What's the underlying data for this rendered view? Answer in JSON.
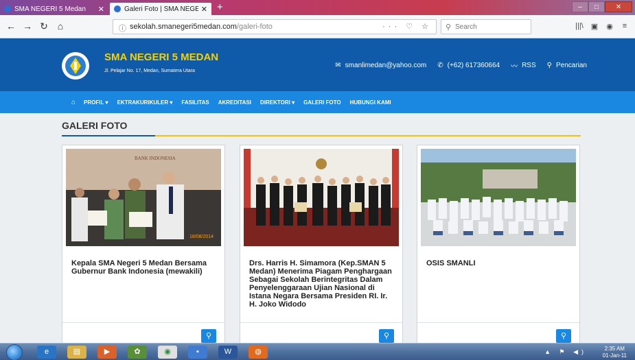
{
  "browser": {
    "tabs": [
      {
        "title": "SMA NEGERI 5 Medan"
      },
      {
        "title": "Galeri Foto | SMA NEGERI 5 Me"
      }
    ],
    "url_domain": "sekolah.smanegeri5medan.com",
    "url_path": "/galeri-foto",
    "search_placeholder": "Search"
  },
  "site": {
    "name": "SMA NEGERI 5 MEDAN",
    "address": "Jl. Pelajar No. 17, Medan, Sumatera Utara",
    "email": "smanlimedan@yahoo.com",
    "phone": "(+62) 617360664",
    "rss": "RSS",
    "search": "Pencarian"
  },
  "menu": {
    "profil": "PROFIL ▾",
    "ekstrakurikuler": "EKTRAKURIKULER ▾",
    "fasilitas": "FASILITAS",
    "akreditasi": "AKREDITASI",
    "direktori": "DIREKTORI ▾",
    "galeri": "GALERI FOTO",
    "kontak": "HUBUNGI KAMI"
  },
  "page": {
    "title": "GALERI FOTO",
    "cards": [
      {
        "caption": "Kepala SMA Negeri 5 Medan Bersama Gubernur Bank Indonesia (mewakili)",
        "photo_banner": "BANK INDONESIA",
        "photo_date": "18/08/2014"
      },
      {
        "caption": "Drs. Harris H. Simamora (Kep.SMAN 5 Medan) Menerima Piagam Penghargaan Sebagai Sekolah Berintegritas Dalam Penyelenggaraan Ujian Nasional di Istana Negara Bersama Presiden RI. Ir. H. Joko Widodo"
      },
      {
        "caption": "OSIS SMANLI"
      }
    ]
  },
  "taskbar": {
    "time": "2:35 AM",
    "date": "01-Jan-11"
  },
  "colors": {
    "header_blue": "#0f5baa",
    "menu_blue": "#1a87e0",
    "accent_yellow": "#f3c20a",
    "school_name_yellow": "#f5d100"
  }
}
